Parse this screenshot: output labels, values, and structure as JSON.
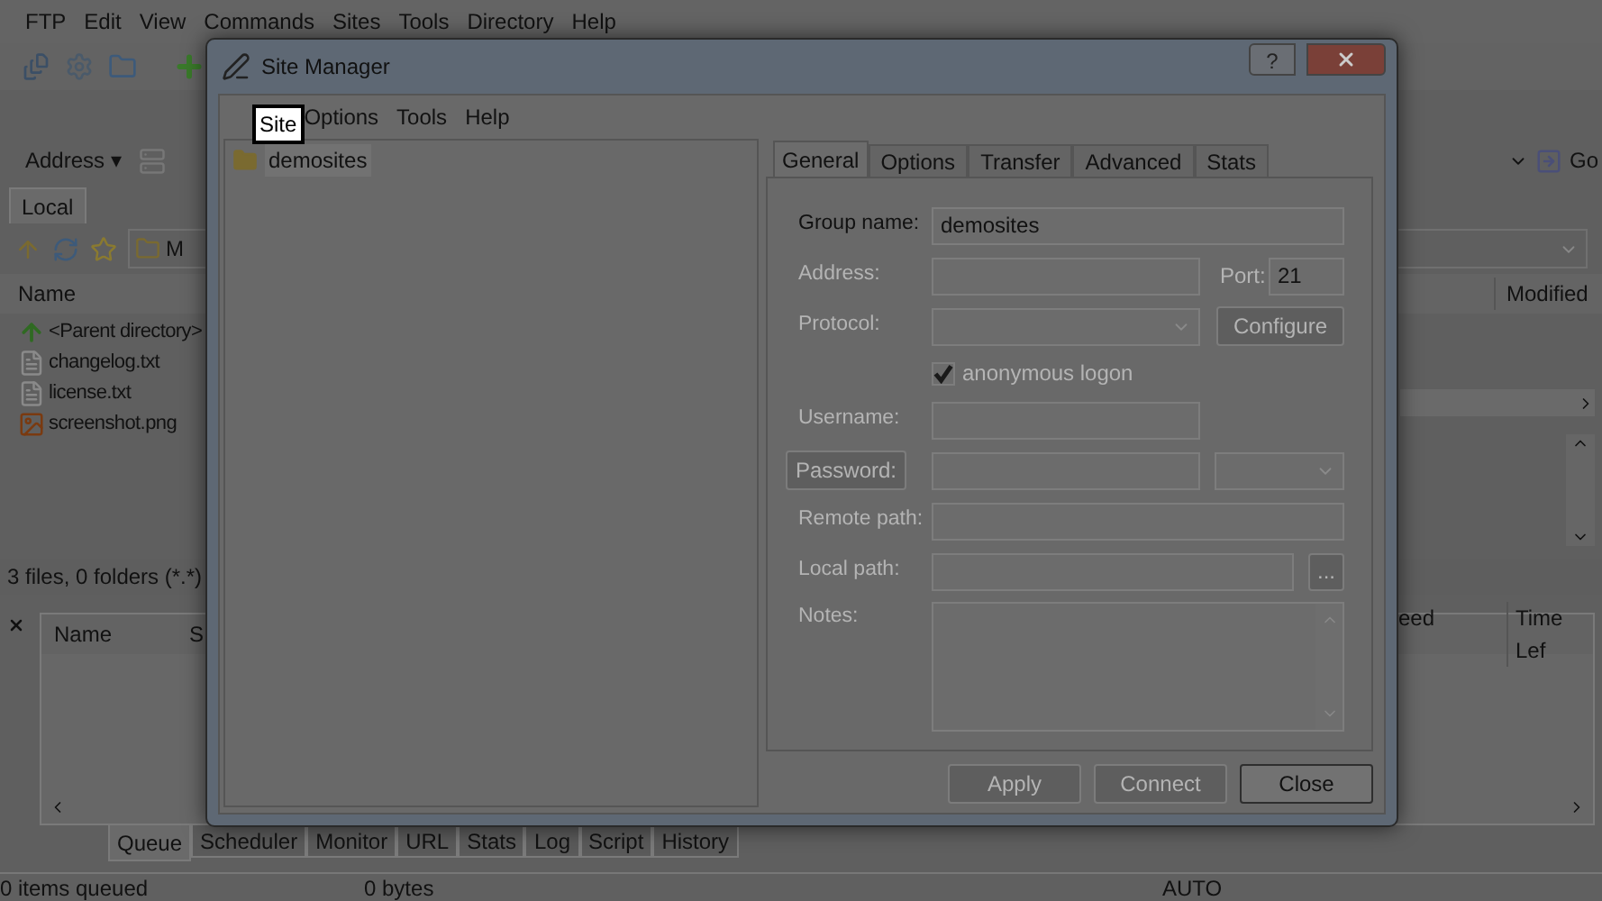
{
  "app": {
    "menu": [
      "FTP",
      "Edit",
      "View",
      "Commands",
      "Sites",
      "Tools",
      "Directory",
      "Help"
    ],
    "address_label": "Address",
    "address_caret": "▾",
    "go_button": "Go",
    "panel_tabs": [
      {
        "label": "Local",
        "selected": true
      }
    ],
    "local_path": "M",
    "file_columns": [
      "Name"
    ],
    "remote_columns": [
      "Modified"
    ],
    "files": [
      {
        "name": "<Parent directory>",
        "kind": "up"
      },
      {
        "name": "changelog.txt",
        "kind": "text"
      },
      {
        "name": "license.txt",
        "kind": "text"
      },
      {
        "name": "screenshot.png",
        "kind": "image"
      }
    ],
    "local_status": "3 files, 0 folders (*.*)",
    "queue_columns": [
      "Name",
      "S"
    ],
    "queue_columns_right": [
      "eed",
      "Time Lef"
    ],
    "queue_tabs": [
      {
        "label": "Queue",
        "selected": true
      },
      {
        "label": "Scheduler",
        "selected": false
      },
      {
        "label": "Monitor",
        "selected": false
      },
      {
        "label": "URL",
        "selected": false
      },
      {
        "label": "Stats",
        "selected": false
      },
      {
        "label": "Log",
        "selected": false
      },
      {
        "label": "Script",
        "selected": false
      },
      {
        "label": "History",
        "selected": false
      }
    ],
    "status_bar": [
      "0 items queued",
      "0 bytes",
      "AUTO"
    ]
  },
  "dialog": {
    "title": "Site Manager",
    "help_button": "?",
    "menu": [
      {
        "label": "Site",
        "highlighted": true
      },
      {
        "label": "Options",
        "highlighted": false
      },
      {
        "label": "Tools",
        "highlighted": false
      },
      {
        "label": "Help",
        "highlighted": false
      }
    ],
    "tree": [
      {
        "label": "demosites",
        "selected": true
      }
    ],
    "tabs": [
      {
        "label": "General",
        "selected": true
      },
      {
        "label": "Options",
        "selected": false
      },
      {
        "label": "Transfer",
        "selected": false
      },
      {
        "label": "Advanced",
        "selected": false
      },
      {
        "label": "Stats",
        "selected": false
      }
    ],
    "fields": [
      {
        "kind": "text",
        "label": "Group name:",
        "disabled": false,
        "value": "demosites",
        "wide": true
      },
      {
        "kind": "port",
        "label": "Address:",
        "disabled": true,
        "port_label": "Port:",
        "port_value": "21"
      },
      {
        "kind": "select",
        "label": "Protocol:",
        "disabled": true,
        "button": "Configure"
      },
      {
        "kind": "checkbox",
        "label": "anonymous logon",
        "disabled": true,
        "checked": true
      },
      {
        "kind": "text",
        "label": "Username:",
        "disabled": true,
        "wide": false
      },
      {
        "kind": "password",
        "label": "Password:",
        "disabled": true
      },
      {
        "kind": "text",
        "label": "Remote path:",
        "disabled": true,
        "wide": true
      },
      {
        "kind": "browse",
        "label": "Local path:",
        "disabled": true,
        "button": "..."
      },
      {
        "kind": "notes",
        "label": "Notes:",
        "disabled": true
      }
    ],
    "buttons": [
      {
        "label": "Apply",
        "disabled": true
      },
      {
        "label": "Connect",
        "disabled": true
      },
      {
        "label": "Close",
        "disabled": false
      }
    ]
  }
}
